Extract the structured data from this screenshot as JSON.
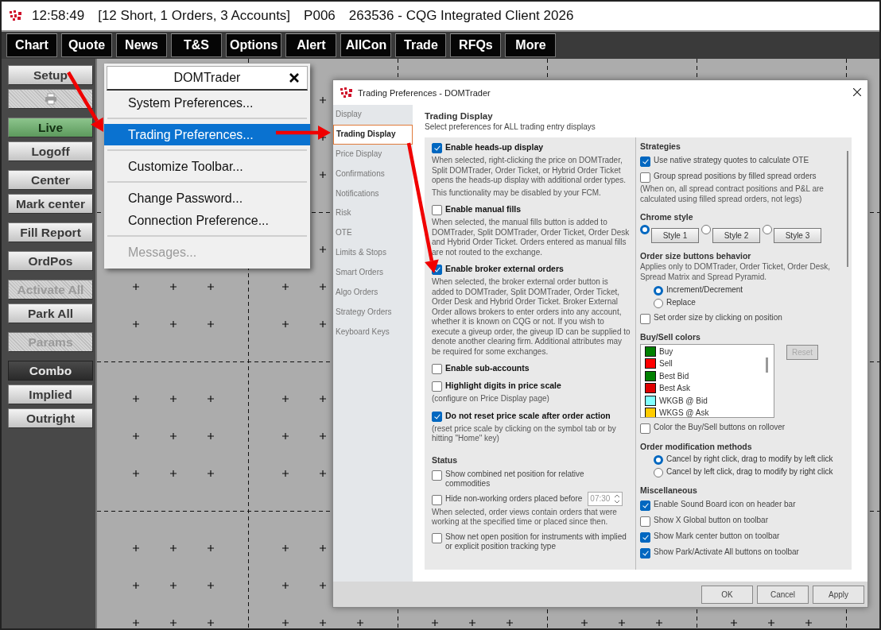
{
  "title_bar": {
    "items": [
      "12:58:49",
      "[12 Short, 1 Orders, 3 Accounts]",
      "P006",
      "263536 - CQG Integrated Client 2026"
    ]
  },
  "menu_bar": [
    {
      "label": "Chart"
    },
    {
      "label": "Quote"
    },
    {
      "label": "News"
    },
    {
      "label": "T&S"
    },
    {
      "label": "Options"
    },
    {
      "label": "Alert"
    },
    {
      "label": "AllCon"
    },
    {
      "label": "Trade"
    },
    {
      "label": "RFQs"
    },
    {
      "label": "More"
    }
  ],
  "toolbar": {
    "groups": [
      {
        "buttons": [
          {
            "kind": "command",
            "label": "Setup",
            "disabled": false
          },
          {
            "kind": "print",
            "disabled": true
          }
        ]
      },
      {
        "buttons": [
          {
            "kind": "connection",
            "label": "Live",
            "selected": true,
            "disabled": false
          },
          {
            "kind": "command",
            "label": "Logoff",
            "disabled": false
          }
        ]
      },
      {
        "buttons": [
          {
            "kind": "command",
            "label": "Center",
            "disabled": false
          },
          {
            "kind": "command",
            "label": "Mark center",
            "disabled": false
          }
        ]
      },
      {
        "buttons": [
          {
            "kind": "command",
            "label": "Fill Report",
            "disabled": false
          }
        ]
      },
      {
        "buttons": [
          {
            "kind": "command",
            "label": "OrdPos",
            "disabled": false
          }
        ]
      },
      {
        "buttons": [
          {
            "kind": "command",
            "label": "Activate All",
            "disabled": true
          },
          {
            "kind": "command",
            "label": "Park All",
            "disabled": false
          }
        ]
      },
      {
        "buttons": [
          {
            "kind": "command",
            "label": "Params",
            "disabled": true
          }
        ]
      },
      {
        "buttons": [
          {
            "kind": "mode",
            "label": "Combo",
            "selected": true,
            "disabled": false
          },
          {
            "kind": "mode",
            "label": "Implied",
            "selected": false,
            "disabled": false
          },
          {
            "kind": "mode",
            "label": "Outright",
            "selected": false,
            "disabled": false
          }
        ]
      }
    ]
  },
  "popup_menu": {
    "title": "DOMTrader",
    "sections": [
      [
        {
          "label": "System Preferences...",
          "selected": false,
          "disabled": false
        }
      ],
      [
        {
          "label": "Trading Preferences...",
          "selected": true,
          "disabled": false
        }
      ],
      [
        {
          "label": "Customize Toolbar...",
          "selected": false,
          "disabled": false
        }
      ],
      [
        {
          "label": "Change Password...",
          "selected": false,
          "disabled": false
        },
        {
          "label": "Connection Preference...",
          "selected": false,
          "disabled": false
        }
      ],
      [
        {
          "label": "Messages...",
          "selected": false,
          "disabled": true
        }
      ]
    ]
  },
  "dialog": {
    "title": "Trading Preferences - DOMTrader",
    "nav": [
      {
        "label": "Display",
        "selected": false
      },
      {
        "label": "Trading Display",
        "selected": true
      },
      {
        "label": "Price Display",
        "selected": false
      },
      {
        "label": "Confirmations",
        "selected": false
      },
      {
        "label": "Notifications",
        "selected": false
      },
      {
        "label": "Risk",
        "selected": false
      },
      {
        "label": "OTE",
        "selected": false
      },
      {
        "label": "Limits & Stops",
        "selected": false
      },
      {
        "label": "Smart Orders",
        "selected": false
      },
      {
        "label": "Algo Orders",
        "selected": false
      },
      {
        "label": "Strategy Orders",
        "selected": false
      },
      {
        "label": "Keyboard Keys",
        "selected": false
      }
    ],
    "heading": "Trading Display",
    "subtitle": "Select preferences for ALL trading entry displays",
    "left_column": [
      {
        "kind": "option",
        "label": "Enable heads-up display",
        "checked": true,
        "description": [
          "When selected, right-clicking the price on DOMTrader, Split DOMTrader, Order Ticket, or Hybrid Order Ticket opens the heads-up display with additional order types.",
          "This functionality may be disabled by your FCM."
        ]
      },
      {
        "kind": "option",
        "label": "Enable manual fills",
        "checked": false,
        "description": [
          "When selected, the manual fills button is added to DOMTrader, Split DOMTrader, Order Ticket, Order Desk and Hybrid Order Ticket. Orders entered as manual fills are not routed to the exchange."
        ]
      },
      {
        "kind": "option",
        "label": "Enable broker external orders",
        "checked": true,
        "description": [
          "When selected, the broker external order button is added to DOMTrader, Split DOMTrader, Order Ticket, Order Desk and Hybrid Order Ticket. Broker External Order allows brokers to enter orders into any account, whether it is known on CQG or not. If you wish to execute a giveup order, the giveup ID can be supplied to denote another clearing firm. Additional attributes may be required for some exchanges."
        ]
      },
      {
        "kind": "option",
        "label": "Enable sub-accounts",
        "checked": false
      },
      {
        "kind": "option",
        "label": "Highlight digits in price scale",
        "checked": false,
        "description": [
          "(configure on Price Display page)"
        ]
      },
      {
        "kind": "option",
        "label": "Do not reset price scale after order action",
        "checked": true,
        "description": [
          "(reset price scale by clicking on the symbol tab or by hitting \"Home\" key)"
        ]
      },
      {
        "kind": "heading",
        "text": "Status"
      },
      {
        "kind": "check",
        "label": "Show combined net position for relative commodities",
        "checked": false
      },
      {
        "kind": "check",
        "label": "Hide non-working orders placed before",
        "checked": false,
        "field": "07:30",
        "description": [
          "When selected, order views contain orders that were working at the specified time or placed since then."
        ]
      },
      {
        "kind": "check",
        "label": "Show net open position for instruments with implied or explicit position tracking type",
        "checked": false
      }
    ],
    "right_column": [
      {
        "kind": "heading",
        "text": "Strategies"
      },
      {
        "kind": "check",
        "label": "Use native strategy quotes to calculate OTE",
        "checked": true
      },
      {
        "kind": "check",
        "label": "Group spread positions by filled spread orders",
        "checked": false,
        "description": [
          "(When on, all spread contract positions and P&L are calculated using filled spread orders, not legs)"
        ]
      },
      {
        "kind": "heading",
        "text": "Chrome style"
      },
      {
        "kind": "style_choice",
        "options": [
          {
            "label": "Style 1",
            "selected": true
          },
          {
            "label": "Style 2",
            "selected": false
          },
          {
            "label": "Style 3",
            "selected": false
          }
        ]
      },
      {
        "kind": "heading",
        "text": "Order size buttons behavior",
        "description": "Applies only to DOMTrader, Order Ticket, Order Desk, Spread Matrix and Spread Pyramid."
      },
      {
        "kind": "radios",
        "options": [
          {
            "label": "Increment/Decrement",
            "selected": true
          },
          {
            "label": "Replace",
            "selected": false
          }
        ]
      },
      {
        "kind": "check",
        "label": "Set order size by clicking on position",
        "checked": false
      },
      {
        "kind": "heading",
        "text": "Buy/Sell colors"
      },
      {
        "kind": "color_list",
        "reset": "Reset",
        "items": [
          {
            "label": "Buy",
            "color": "#008000"
          },
          {
            "label": "Sell",
            "color": "#ff0000"
          },
          {
            "label": "Best Bid",
            "color": "#008000"
          },
          {
            "label": "Best Ask",
            "color": "#e00000"
          },
          {
            "label": "WKGB @ Bid",
            "color": "#80ffff"
          },
          {
            "label": "WKGS @ Ask",
            "color": "#ffcc00"
          }
        ]
      },
      {
        "kind": "check",
        "label": "Color the Buy/Sell buttons on rollover",
        "checked": false
      },
      {
        "kind": "heading",
        "text": "Order modification methods"
      },
      {
        "kind": "radios",
        "options": [
          {
            "label": "Cancel by right click, drag to modify by left click",
            "selected": true
          },
          {
            "label": "Cancel by left click, drag to modify by right click",
            "selected": false
          }
        ]
      },
      {
        "kind": "heading",
        "text": "Miscellaneous"
      },
      {
        "kind": "check",
        "label": "Enable Sound Board icon on header bar",
        "checked": true
      },
      {
        "kind": "check",
        "label": "Show X Global button on toolbar",
        "checked": false
      },
      {
        "kind": "check",
        "label": "Show Mark center button on toolbar",
        "checked": true
      },
      {
        "kind": "check",
        "label": "Show Park/Activate All buttons on toolbar",
        "checked": true
      }
    ],
    "buttons": [
      "OK",
      "Cancel",
      "Apply"
    ]
  }
}
